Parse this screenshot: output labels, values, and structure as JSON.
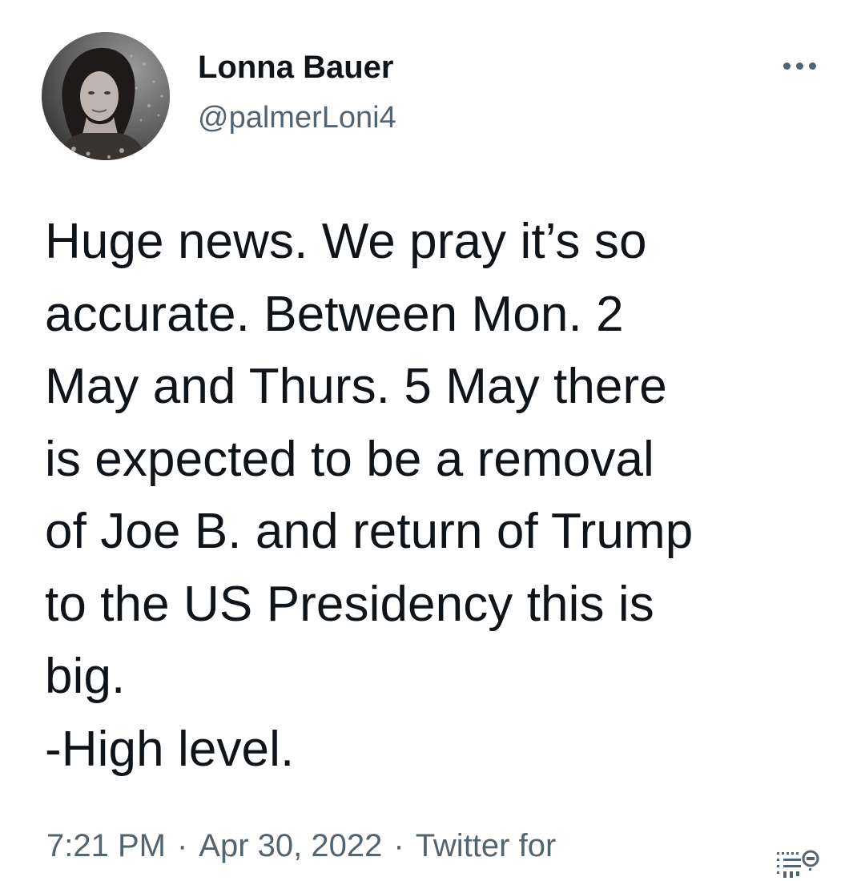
{
  "tweet": {
    "author": {
      "display_name": "Lonna Bauer",
      "handle": "@palmerLoni4",
      "avatar_icon": "profile-photo"
    },
    "more_icon": "more-horizontal-icon",
    "text": "Huge news. We pray it’s so\naccurate. Between Mon. 2\nMay and Thurs. 5 May there\nis expected to be a removal\nof Joe B. and return of Trump\nto the US Presidency this is\nbig.\n-High level.",
    "meta": {
      "time": "7:21 PM",
      "date": "Apr 30, 2022",
      "source": "Twitter for",
      "separator": "·"
    },
    "corner_icon": "watermark-icon"
  },
  "colors": {
    "text_primary": "#0f1419",
    "text_secondary": "#536471",
    "background": "#ffffff"
  }
}
